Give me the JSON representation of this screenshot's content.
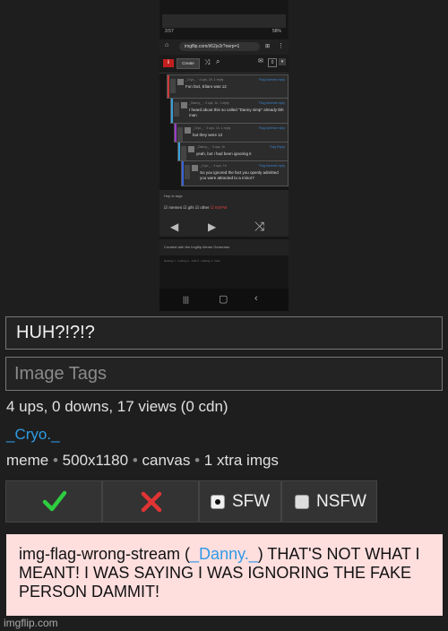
{
  "phone": {
    "status_time": "3:57",
    "status_battery": "58%",
    "url": "imgflip.com/i/62jv2r?nerp=1",
    "tab_count": "0",
    "logo_text": "i",
    "create_label": "Create",
    "comments": [
      {
        "user": "_Cryo._",
        "meta": "_Cryo._ · 4 ups, 2h, 1 reply",
        "flag": "Flag Adverse reply",
        "text": "Fun fact, Eliaro was 12",
        "color": "#c93a3a"
      },
      {
        "user": "_Danny._",
        "meta": "_Danny._ · 4 ups, 1h, 1 reply",
        "flag": "Flag Adverse reply",
        "text": "I heard about this so called \"Danny simp\" already tbh man",
        "color": "#3aa0d8"
      },
      {
        "user": "_Cryo._",
        "meta": "_Cryo._ · 3 ups, 1h, 1 reply",
        "flag": "Flag Adverse reply",
        "text": "but they were 12",
        "color": "#9a3ac9"
      },
      {
        "user": "_Danny._",
        "meta": "_Danny._ · 3 ups, 1h",
        "flag": "Flag Reply",
        "text": "yeah, but i had been ignoring it",
        "color": "#3aa0d8"
      },
      {
        "user": "_Cryo._",
        "meta": "_Cryo._ · 4 ups, 1h",
        "flag": "Flag Adverse reply",
        "text": "So you ignored the fact you openly admitted you were attracted to a minor?",
        "color": "#3a62d8"
      }
    ],
    "tags_label": "Hop to tags",
    "tag_options": [
      "memes",
      "gifs",
      "other",
      "NSFW"
    ],
    "created_text": "Created with the Imgflip Meme Generator",
    "footer_text": "Nothing 1 · nothing 2 · stuff 3 · nothing 4 · back"
  },
  "form": {
    "title_value": "HUH?!?!?",
    "tags_placeholder": "Image Tags"
  },
  "stats": "4 ups, 0 downs, 17 views (0 cdn)",
  "uploader": "_Cryo._",
  "meta": {
    "type": "meme",
    "size": "500x1180",
    "mode": "canvas",
    "extra": "1 xtra imgs",
    "sep": "•"
  },
  "actions": {
    "approve_icon": "checkmark-icon",
    "reject_icon": "x-icon",
    "sfw_label": "SFW",
    "nsfw_label": "NSFW",
    "sfw_selected": true
  },
  "note": {
    "prefix": "img-flag-wrong-stream (",
    "user": "_Danny._",
    "suffix": ") THAT'S NOT WHAT I MEANT! I WAS SAYING I WAS IGNORING THE FAKE PERSON DAMMIT!"
  },
  "watermark": "imgflip.com",
  "colors": {
    "accent_blue": "#2f9be6",
    "approve_green": "#2ecc40",
    "reject_red": "#e03434",
    "note_bg": "#ffdede"
  }
}
